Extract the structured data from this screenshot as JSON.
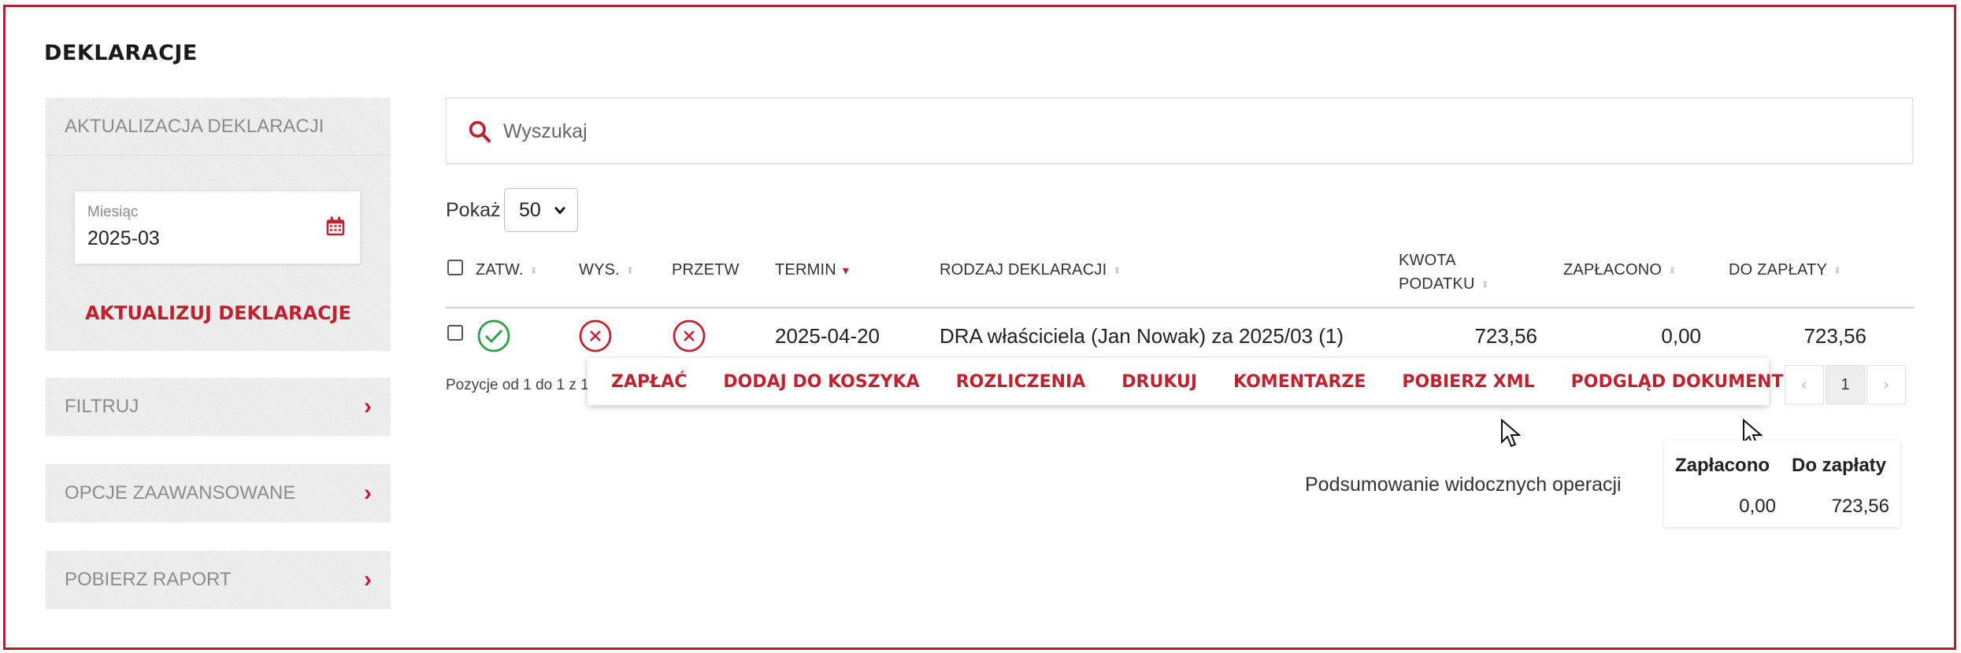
{
  "page": {
    "title": "DEKLARACJE"
  },
  "sidebar": {
    "update_panel": {
      "title": "AKTUALIZACJA DEKLARACJI",
      "month_label": "Miesiąc",
      "month_value": "2025-03",
      "update_button": "AKTUALIZUJ DEKLARACJE"
    },
    "filter": "FILTRUJ",
    "advanced": "OPCJE ZAAWANSOWANE",
    "report": "POBIERZ RAPORT"
  },
  "search": {
    "placeholder": "Wyszukaj"
  },
  "show": {
    "label": "Pokaż",
    "value": "50"
  },
  "table": {
    "columns": {
      "approved": "ZATW.",
      "sent": "WYS.",
      "processed": "PRZETW",
      "deadline": "TERMIN",
      "type": "RODZAJ DEKLARACJI",
      "tax_line1": "KWOTA",
      "tax_line2": "PODATKU",
      "paid": "ZAPŁACONO",
      "due": "DO ZAPŁATY"
    },
    "rows": [
      {
        "approved": "yes",
        "sent": "no",
        "processed": "no",
        "deadline": "2025-04-20",
        "type": "DRA właściciela (Jan Nowak) za 2025/03 (1)",
        "tax": "723,56",
        "paid": "0,00",
        "due": "723,56"
      }
    ],
    "positions_text": "Pozycje od 1 do 1 z 1"
  },
  "actions": [
    "ZAPŁAĆ",
    "DODAJ DO KOSZYKA",
    "ROZLICZENIA",
    "DRUKUJ",
    "KOMENTARZE",
    "POBIERZ XML",
    "PODGLĄD DOKUMENTU"
  ],
  "pagination": {
    "prev": "‹",
    "current": "1",
    "next": "›"
  },
  "summary": {
    "label": "Podsumowanie widocznych operacji",
    "paid_header": "Zapłacono",
    "due_header": "Do zapłaty",
    "paid_value": "0,00",
    "due_value": "723,56"
  },
  "colors": {
    "accent": "#c0212f",
    "success": "#2e9e48",
    "frame": "#b3202f"
  }
}
